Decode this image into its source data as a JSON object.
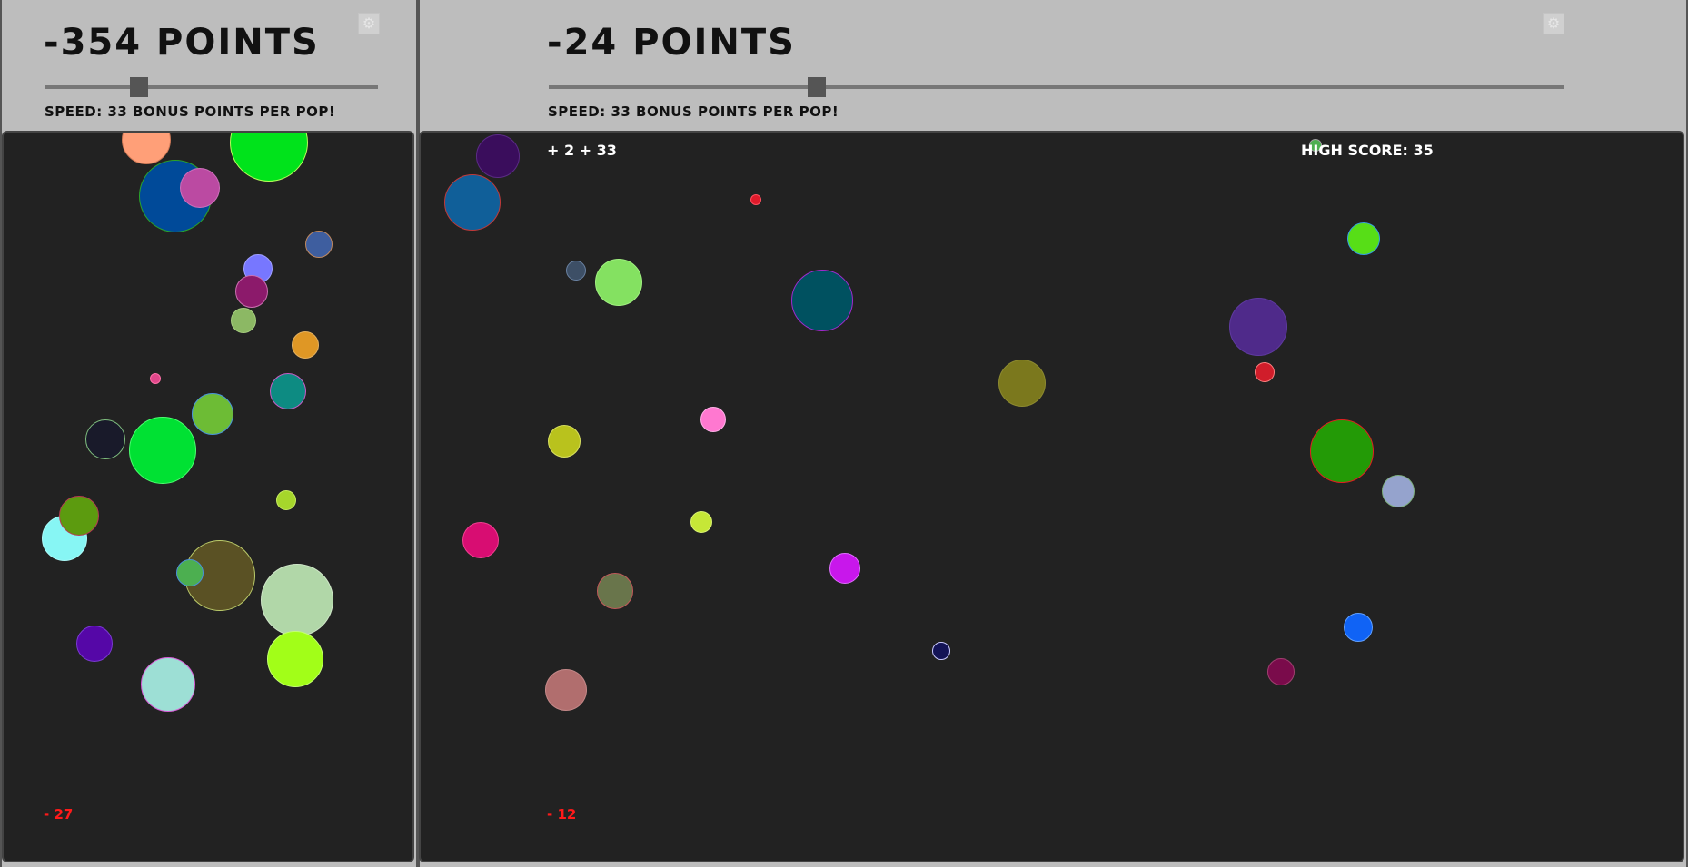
{
  "colors": {
    "panel_bg": "#bdbdbd",
    "board_bg": "#222222",
    "miss_text": "#ff1a1a",
    "floor_line": "#cc0000"
  },
  "left_player": {
    "score_label": "-354 POINTS",
    "speed_text": "SPEED: 33 BONUS POINTS PER POP!",
    "speed_value": 0.27,
    "settings_icon": "gear-icon",
    "missed_label": "- 27",
    "bubbles": [
      {
        "color": "#ff9f78",
        "edge": "#d27b58"
      },
      {
        "color": "#00e31b",
        "edge": "#b6ff5a"
      },
      {
        "color": "#004a99",
        "edge": "#2aa52a"
      },
      {
        "color": "#bb4aa2",
        "edge": "#d070bd"
      },
      {
        "color": "#3e5e9f",
        "edge": "#c08a62"
      },
      {
        "color": "#7777ff",
        "edge": "#a0a0ff"
      },
      {
        "color": "#8c1a6b",
        "edge": "#cc6fb0"
      },
      {
        "color": "#8cb864",
        "edge": "#a8d080"
      },
      {
        "color": "#df9725",
        "edge": "#e3b060"
      },
      {
        "color": "#e0478a",
        "edge": "#ff6fa8"
      },
      {
        "color": "#0d8b82",
        "edge": "#c85ec8"
      },
      {
        "color": "#6dbc35",
        "edge": "#4a96d8"
      },
      {
        "color": "#191a2a",
        "edge": "#7fbf7f"
      },
      {
        "color": "#00e133",
        "edge": "#4cff70"
      },
      {
        "color": "#a6d62b",
        "edge": "#c8ec60"
      },
      {
        "color": "#87f6f4",
        "edge": "#aafbfa"
      },
      {
        "color": "#5c9b0f",
        "edge": "#b63c52"
      },
      {
        "color": "#5a5124",
        "edge": "#bccc6a"
      },
      {
        "color": "#4caf50",
        "edge": "#4a90d8"
      },
      {
        "color": "#b1d7a8",
        "edge": "#cfe7c8"
      },
      {
        "color": "#5507a7",
        "edge": "#7a3ad2"
      },
      {
        "color": "#a2fe18",
        "edge": "#c3ff70"
      },
      {
        "color": "#9ddfd5",
        "edge": "#d85ed8"
      }
    ]
  },
  "right_player": {
    "score_label": "-24 POINTS",
    "speed_text": "SPEED: 33 BONUS POINTS PER POP!",
    "speed_value": 0.26,
    "settings_icon": "gear-icon",
    "pop_bonus_label": "+ 2 + 33",
    "high_score_label": "HIGH SCORE: 35",
    "missed_label": "- 12",
    "bubbles": [
      {
        "color": "#3a0d5c",
        "edge": "#5b2b86"
      },
      {
        "color": "#105f99",
        "edge": "#c23a3a"
      },
      {
        "color": "#e01b2b",
        "edge": "#ff5060"
      },
      {
        "color": "#3d4f66",
        "edge": "#6a82a2"
      },
      {
        "color": "#84e161",
        "edge": "#a0f080"
      },
      {
        "color": "#005160",
        "edge": "#a02ad0"
      },
      {
        "color": "#4f2a8a",
        "edge": "#5f3aa0"
      },
      {
        "color": "#d01d2a",
        "edge": "#ff8080"
      },
      {
        "color": "#57de17",
        "edge": "#35a0e0"
      },
      {
        "color": "#7b781d",
        "edge": "#8d8a30"
      },
      {
        "color": "#ff78d0",
        "edge": "#ffb0e8"
      },
      {
        "color": "#b9c21d",
        "edge": "#d8e060"
      },
      {
        "color": "#239a06",
        "edge": "#e02020"
      },
      {
        "color": "#95a3cd",
        "edge": "#7fb07f"
      },
      {
        "color": "#d80d72",
        "edge": "#f04090"
      },
      {
        "color": "#c6e737",
        "edge": "#d8f070"
      },
      {
        "color": "#c817eb",
        "edge": "#e070ff"
      },
      {
        "color": "#69754b",
        "edge": "#c25a5a"
      },
      {
        "color": "#1063f5",
        "edge": "#60a0ff"
      },
      {
        "color": "#131356",
        "edge": "#c8c8ff"
      },
      {
        "color": "#7a0b4b",
        "edge": "#a04070"
      },
      {
        "color": "#b16e6e",
        "edge": "#c48888"
      },
      {
        "color": "#4caf50",
        "edge": "#a0a0a0"
      }
    ]
  }
}
